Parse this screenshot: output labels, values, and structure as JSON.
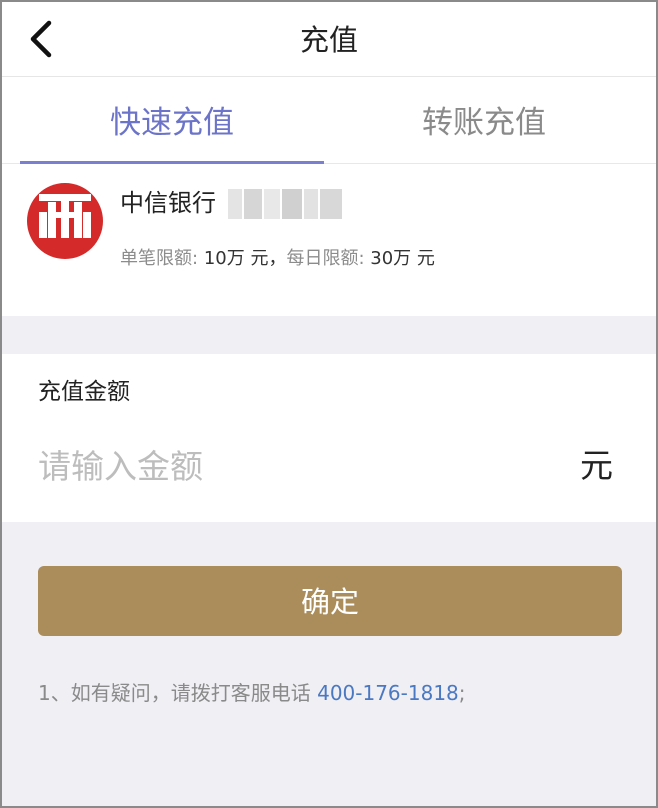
{
  "header": {
    "title": "充值",
    "back_icon": "chevron-left-icon"
  },
  "tabs": [
    {
      "label": "快速充值",
      "active": true
    },
    {
      "label": "转账充值",
      "active": false
    }
  ],
  "bank": {
    "name": "中信银行",
    "logo": "citic-bank-logo",
    "single_limit_label": "单笔限额:",
    "single_limit_value": "10万 元",
    "separator": "，",
    "daily_limit_label": "每日限额:",
    "daily_limit_value": "30万 元"
  },
  "amount": {
    "label": "充值金额",
    "placeholder": "请输入金额",
    "value": "",
    "unit": "元"
  },
  "confirm_label": "确定",
  "notice": {
    "text": "1、如有疑问，请拨打客服电话 ",
    "phone": "400-176-1818",
    "suffix": ";"
  },
  "colors": {
    "accent": "#6c74c9",
    "confirm": "#ab8c5b",
    "link": "#4a78c2",
    "logo_red": "#d42a2a"
  }
}
